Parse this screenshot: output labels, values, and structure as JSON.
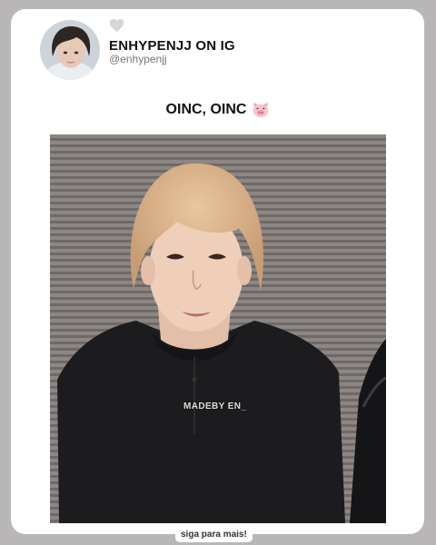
{
  "post": {
    "account_name": "ENHYPENJJ ON IG",
    "account_handle": "@enhypenjj",
    "caption": "OINC, OINC",
    "caption_emoji_icon": "pig-face-icon",
    "watermark": "MADEBY EN_",
    "call_to_action": "siga para mais!"
  },
  "icons": {
    "like": "heart-icon"
  },
  "colors": {
    "background": "#b9b6b8",
    "card": "#ffffff",
    "text_primary": "#111111",
    "text_secondary": "#777777"
  }
}
